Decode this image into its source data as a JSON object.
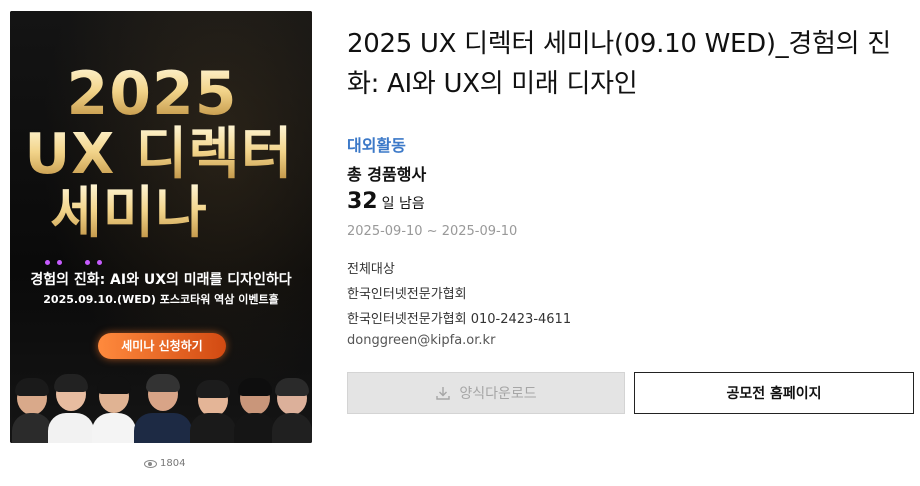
{
  "poster": {
    "year": "2025",
    "line2": "UX 디렉터",
    "line3": "세미나",
    "subtitle": "경험의 진화: AI와 UX의 미래를 디자인하다",
    "date_place": "2025.09.10.(WED) 포스코타워 역삼 이벤트홀",
    "cta": "세미나 신청하기"
  },
  "views": "1804",
  "title": "2025 UX 디렉터 세미나(09.10 WED)_경험의 진화: AI와 UX의 미래 디자인",
  "category": "대외활동",
  "prize": "총 경품행사",
  "dday": {
    "num": "32",
    "unit": "일 남음"
  },
  "dates": "2025-09-10 ~ 2025-09-10",
  "target": "전체대상",
  "host": "한국인터넷전문가협회",
  "contact": "한국인터넷전문가협회 010-2423-4611",
  "email": "donggreen@kipfa.or.kr",
  "buttons": {
    "download": "양식다운로드",
    "homepage": "공모전 홈페이지"
  },
  "colors": {
    "category": "#3c79c8",
    "cta": "#e0601f",
    "download_bg": "#e4e4e4"
  }
}
